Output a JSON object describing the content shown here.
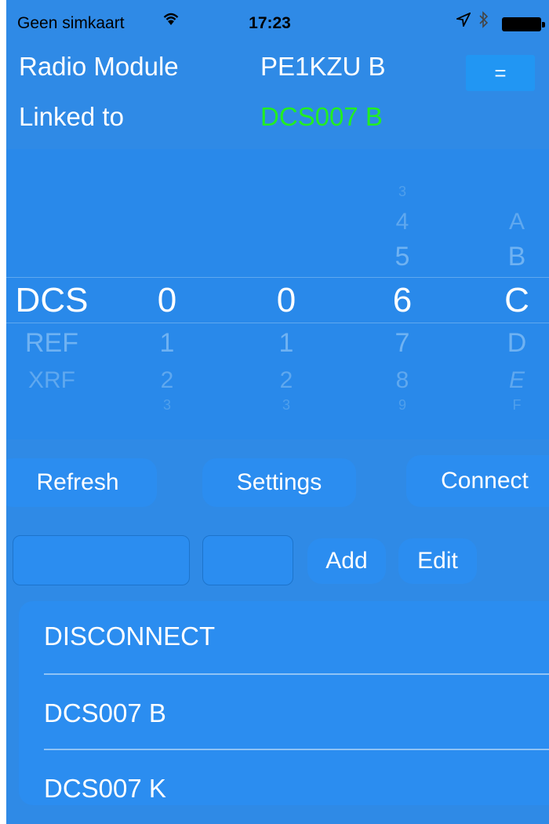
{
  "status_bar": {
    "carrier": "Geen simkaart",
    "time": "17:23"
  },
  "header": {
    "radio_module_label": "Radio Module",
    "radio_module_value": "PE1KZU B",
    "menu_button": "=",
    "linked_to_label": "Linked to",
    "linked_to_value": "DCS007 B",
    "linked_color": "#22ee22"
  },
  "picker": {
    "col1": {
      "above": [
        "",
        ""
      ],
      "selected": "DCS",
      "below": [
        "REF",
        "XRF"
      ]
    },
    "col2": {
      "selected": "0",
      "below": [
        "1",
        "2",
        "3"
      ]
    },
    "col3": {
      "selected": "0",
      "below": [
        "1",
        "2",
        "3"
      ]
    },
    "col4": {
      "above": [
        "3",
        "4",
        "5"
      ],
      "selected": "6",
      "below": [
        "7",
        "8",
        "9"
      ]
    },
    "col5": {
      "above": [
        "A",
        "B"
      ],
      "selected": "C",
      "below": [
        "D",
        "E",
        "F"
      ]
    }
  },
  "actions": {
    "refresh": "Refresh",
    "settings": "Settings",
    "connect": "Connect"
  },
  "add_row": {
    "field1_value": "",
    "field2_value": "",
    "add": "Add",
    "edit": "Edit"
  },
  "list": {
    "items": [
      "DISCONNECT",
      "DCS007 B",
      "DCS007 K"
    ]
  }
}
